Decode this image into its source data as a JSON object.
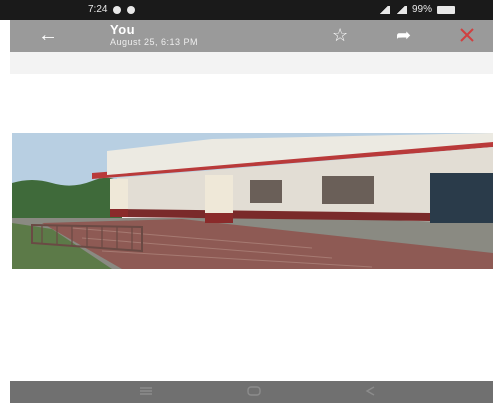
{
  "status_bar": {
    "time": "7:24",
    "battery": "99%"
  },
  "toolbar": {
    "title": "You",
    "subtitle": "August 25, 6:13 PM",
    "back_icon": "arrow-back-icon",
    "star_icon": "star-outline-icon",
    "share_icon": "share-arrow-icon",
    "more_icon": "tools-icon"
  },
  "photo": {
    "subject": "building-with-veranda-photo"
  },
  "nav_bar": {
    "buttons": [
      "recents-button",
      "home-button",
      "back-button"
    ]
  },
  "colors": {
    "status_bar": "#1a1a1a",
    "toolbar": "#9a9a9a",
    "nav_bar": "#707070"
  }
}
